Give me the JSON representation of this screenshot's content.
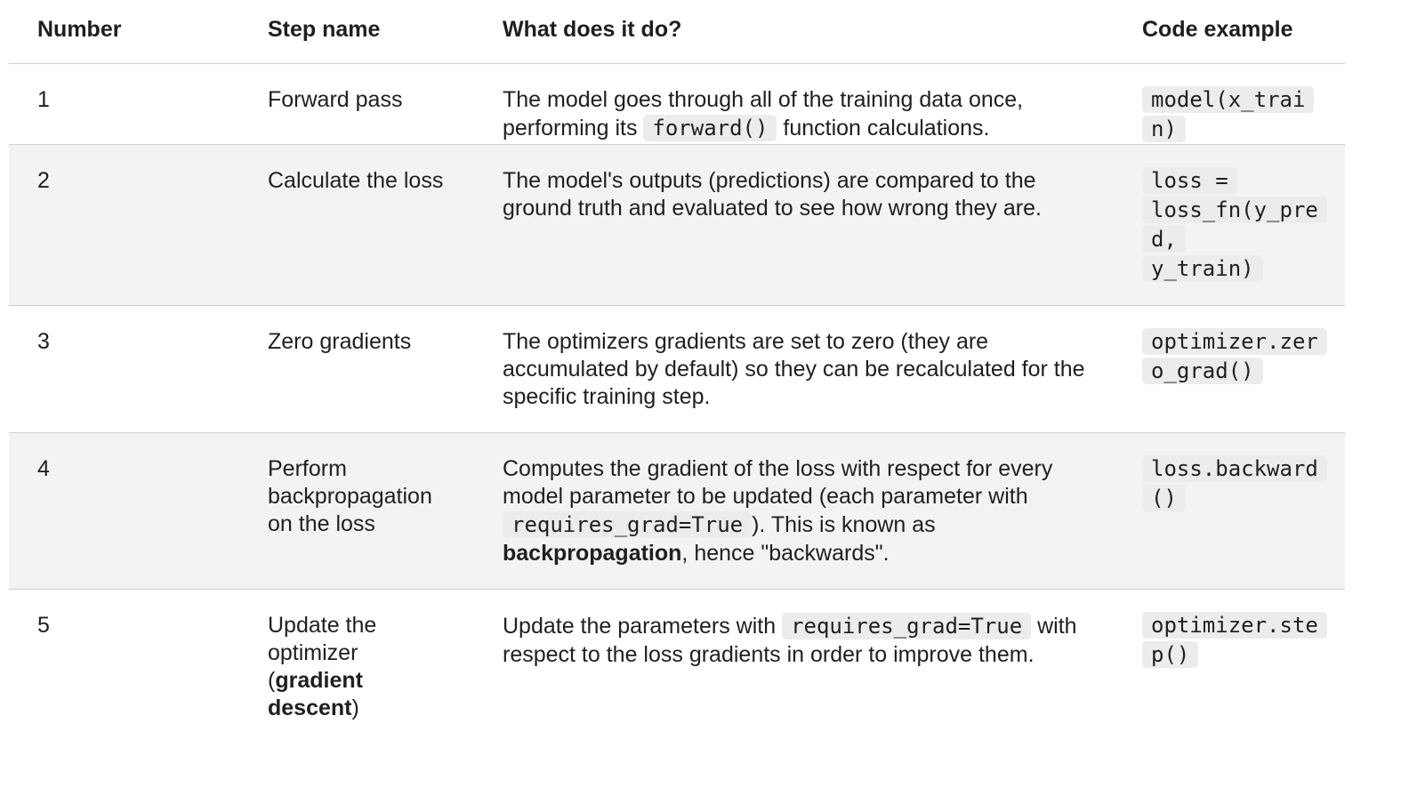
{
  "headers": {
    "number": "Number",
    "step_name": "Step name",
    "what": "What does it do?",
    "code": "Code example"
  },
  "rows": [
    {
      "number": "1",
      "step_name": "Forward pass",
      "desc_a": "The model goes through all of the training data once, performing its ",
      "desc_code": "forward()",
      "desc_b": " function calculations.",
      "code": "model(x_train)"
    },
    {
      "number": "2",
      "step_name": "Calculate the loss",
      "desc_a": "The model's outputs (predictions) are compared to the ground truth and evaluated to see how wrong they are.",
      "code_1": "loss =",
      "code_2": "loss_fn(y_pred,",
      "code_3": "y_train)"
    },
    {
      "number": "3",
      "step_name": "Zero gradients",
      "desc_a": "The optimizers gradients are set to zero (they are accumulated by default) so they can be recalculated for the specific training step.",
      "code": "optimizer.zero_grad()"
    },
    {
      "number": "4",
      "step_name": "Perform backpropagation on the loss",
      "desc_a": "Computes the gradient of the loss with respect for every model parameter to be updated (each parameter with ",
      "desc_code": "requires_grad=True",
      "desc_b": "). This is known as ",
      "desc_bold": "backpropagation",
      "desc_c": ", hence \"backwards\".",
      "code": "loss.backward()"
    },
    {
      "number": "5",
      "step_name_a": "Update the optimizer (",
      "step_name_bold": "gradient descent",
      "step_name_b": ")",
      "desc_a": "Update the parameters with ",
      "desc_code": "requires_grad=True",
      "desc_b": " with respect to the loss gradients in order to improve them.",
      "code": "optimizer.step()"
    }
  ]
}
